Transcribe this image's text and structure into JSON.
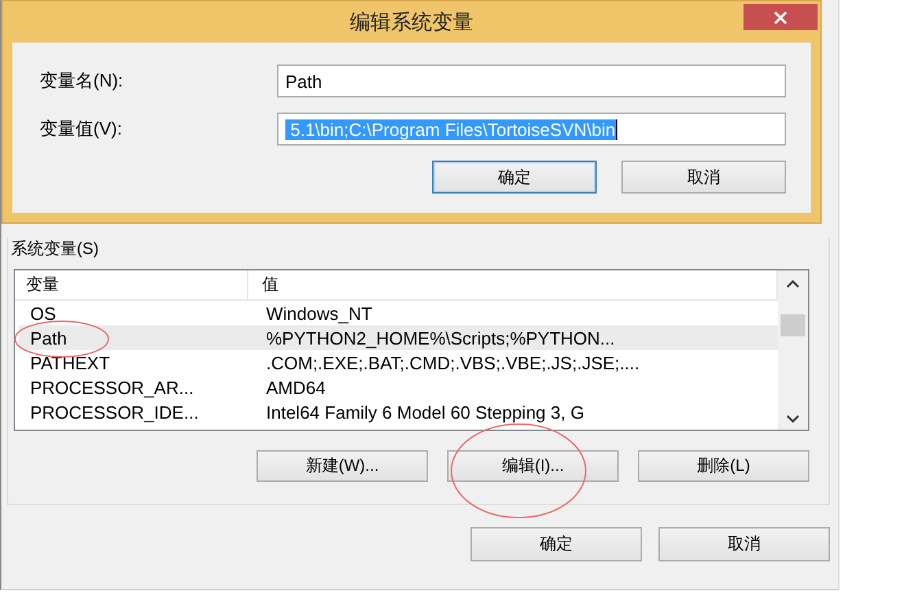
{
  "dialog": {
    "title": "编辑系统变量",
    "fields": [
      {
        "label": "变量名(N):",
        "value": "Path",
        "selected": false
      },
      {
        "label": "变量值(V):",
        "value": " 5.1\\bin;C:\\Program Files\\TortoiseSVN\\bin",
        "selected": true
      }
    ],
    "buttons": [
      {
        "label": "确定",
        "selected": true
      },
      {
        "label": "取消",
        "selected": false
      }
    ]
  },
  "system_variables": {
    "title": "系统变量(S)",
    "columns": [
      "变量",
      "值"
    ],
    "rows": [
      {
        "name": "OS",
        "value": "Windows_NT",
        "selected": false
      },
      {
        "name": "Path",
        "value": "%PYTHON2_HOME%\\Scripts;%PYTHON...",
        "selected": true
      },
      {
        "name": "PATHEXT",
        "value": ".COM;.EXE;.BAT;.CMD;.VBS;.VBE;.JS;.JSE;....",
        "selected": false
      },
      {
        "name": "PROCESSOR_AR...",
        "value": "AMD64",
        "selected": false
      },
      {
        "name": "PROCESSOR_IDE...",
        "value": "Intel64 Family 6 Model 60 Stepping 3, G",
        "selected": false
      }
    ],
    "buttons": [
      "新建(W)...",
      "编辑(I)...",
      "删除(L)"
    ]
  },
  "buttons": [
    "确定",
    "取消"
  ]
}
